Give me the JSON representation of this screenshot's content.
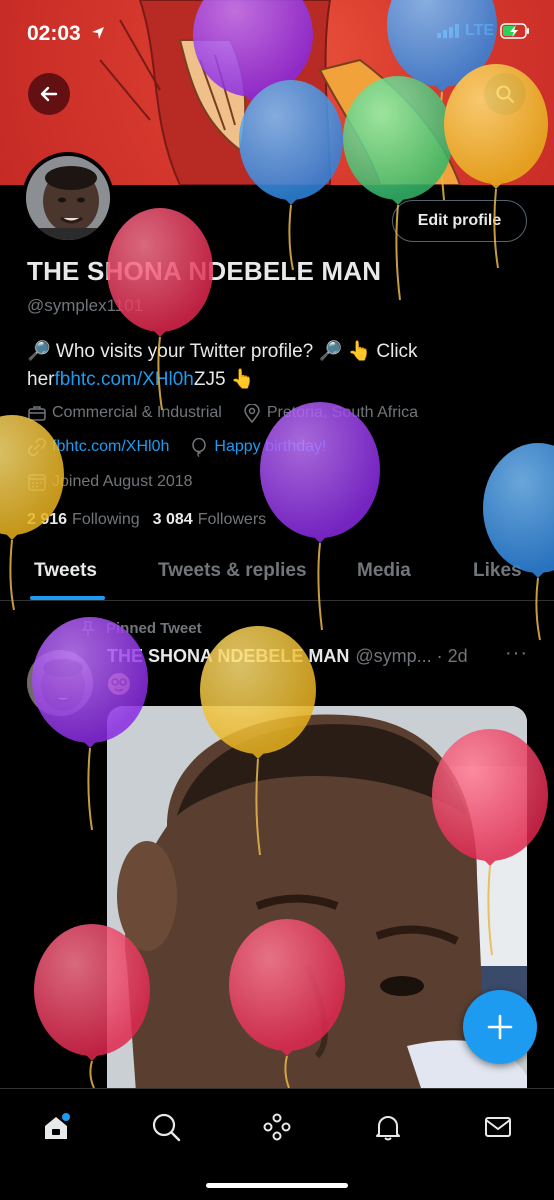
{
  "status_bar": {
    "time": "02:03",
    "network": "LTE"
  },
  "profile": {
    "name": "THE SHONA NDEBELE MAN",
    "handle": "@symplex1101",
    "edit_label": "Edit profile",
    "bio": {
      "part1": "🔎 Who visits your Twitter profile? 🔎 👆 Click her",
      "link": "fbhtc.com/XHl0h",
      "part2": "ZJ5 👆"
    },
    "category": "Commercial & Industrial",
    "location": "Pretoria, South Africa",
    "website": "fbhtc.com/XHl0h",
    "birthday": "Happy birthday!",
    "joined": "Joined August 2018",
    "following_count": "2 916",
    "following_label": "Following",
    "followers_count": "3 084",
    "followers_label": "Followers"
  },
  "tabs": [
    {
      "label": "Tweets",
      "active": true
    },
    {
      "label": "Tweets & replies",
      "active": false
    },
    {
      "label": "Media",
      "active": false
    },
    {
      "label": "Likes",
      "active": false
    }
  ],
  "pinned_tweet": {
    "pinned_label": "Pinned Tweet",
    "author_name": "THE SHONA NDEBELE MAN",
    "author_handle": "@symp...",
    "age": "· 2d",
    "more": "···"
  },
  "icons": {
    "back": "arrow-left-icon",
    "search": "search-icon",
    "compose": "plus-icon",
    "nav": [
      "home-icon",
      "search-icon",
      "spaces-icon",
      "bell-icon",
      "mail-icon"
    ]
  },
  "colors": {
    "accent": "#1d9bf0",
    "background": "#000000",
    "secondary_text": "#71767b",
    "banner": "#d83a2e"
  }
}
